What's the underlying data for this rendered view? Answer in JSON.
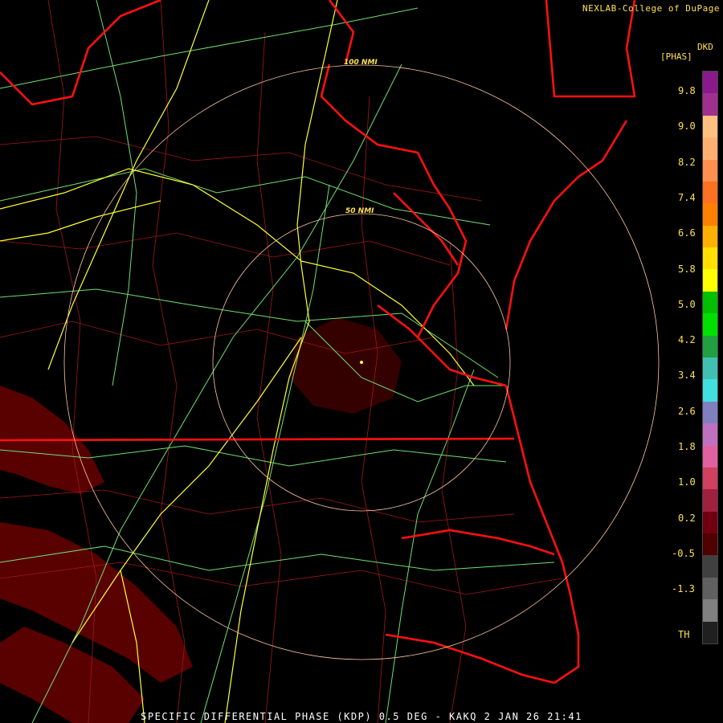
{
  "credit": "NEXLAB-College of DuPage",
  "footer": "SPECIFIC DIFFERENTIAL PHASE (KDP) 0.5 DEG - KAKQ 2 JAN 26 21:41",
  "range_rings": [
    {
      "label": "50 NMI"
    },
    {
      "label": "100 NMI"
    }
  ],
  "legend": {
    "product_code": "DKD",
    "unit": "[PHAS]",
    "ticks": [
      "9.8",
      "9.0",
      "8.2",
      "7.4",
      "6.6",
      "5.8",
      "5.0",
      "4.2",
      "3.4",
      "2.6",
      "1.8",
      "1.0",
      "0.2",
      "-0.5",
      "-1.3",
      "TH"
    ],
    "colors": [
      "#8a1a8c",
      "#a03090",
      "#ffc080",
      "#ffb070",
      "#ff9050",
      "#ff7020",
      "#ff8000",
      "#ffb000",
      "#ffe000",
      "#ffff00",
      "#00c000",
      "#00e000",
      "#20a040",
      "#40c0b0",
      "#40e0e0",
      "#8080c0",
      "#c070c0",
      "#e060a0",
      "#d04060",
      "#a02040",
      "#700010",
      "#500000",
      "#404040",
      "#606060",
      "#808080",
      "#202020"
    ]
  },
  "map_colors": {
    "state_border": "#ff1010",
    "county_border": "#b01818",
    "highway": "#ffff40",
    "road": "#80ff80",
    "range_ring": "#ffc8a0",
    "echo": "#7a0000"
  }
}
